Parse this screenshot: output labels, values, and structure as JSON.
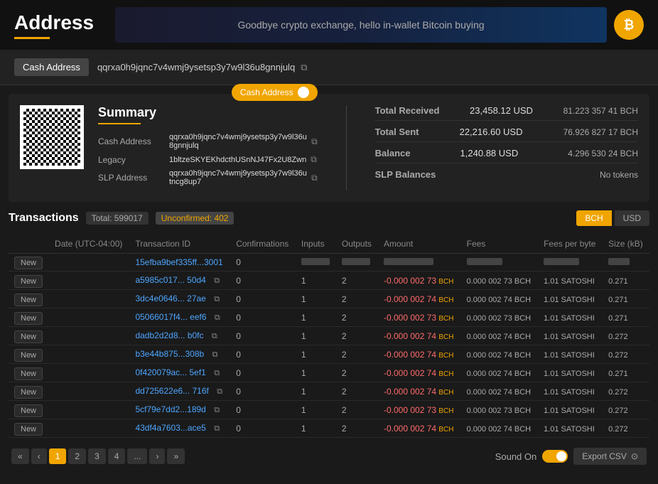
{
  "header": {
    "title": "Address",
    "banner_text": "Goodbye crypto exchange, hello in-wallet Bitcoin buying",
    "bitcoin_icon": "₿"
  },
  "address_bar": {
    "label": "Cash Address",
    "value": "qqrxa0h9jqnc7v4wmj9ysetsp3y7w9l36u8gnnjulq"
  },
  "summary": {
    "title": "Summary",
    "toggle_label": "Cash Address",
    "cash_address_label": "Cash Address",
    "cash_address_value": "qqrxa0h9jqnc7v4wmj9ysetsp3y7w9l36u8gnnjulq",
    "legacy_label": "Legacy",
    "legacy_value": "1bltzeSKYEKhdcthUSnNJ47Fx2U8Zwn",
    "slp_address_label": "SLP Address",
    "slp_address_value": "qqrxa0h9jqnc7v4wmj9ysetsp3y7w9l36utncg8up7",
    "total_received_label": "Total Received",
    "total_received_usd": "23,458.12 USD",
    "total_received_bch": "81.223 357 41 BCH",
    "total_sent_label": "Total Sent",
    "total_sent_usd": "22,216.60 USD",
    "total_sent_bch": "76.926 827 17 BCH",
    "balance_label": "Balance",
    "balance_usd": "1,240.88 USD",
    "balance_bch": "4.296 530 24 BCH",
    "slp_balances_label": "SLP Balances",
    "slp_balances_value": "No tokens"
  },
  "transactions": {
    "title": "Transactions",
    "total_badge": "Total: 599017",
    "unconfirmed_badge": "Unconfirmed: 402",
    "btn_bch": "BCH",
    "btn_usd": "USD",
    "columns": [
      "Date (UTC-04:00)",
      "Transaction ID",
      "Confirmations",
      "Inputs",
      "Outputs",
      "Amount",
      "Fees",
      "Fees per byte",
      "Size (kB)"
    ],
    "rows": [
      {
        "is_new": true,
        "date": "",
        "tx_id": "15efba9bef335ff...3001",
        "confirmations": "0",
        "inputs": "",
        "outputs": "",
        "amount": "",
        "fees": "",
        "fees_per_byte": "",
        "size": ""
      },
      {
        "is_new": true,
        "date": "",
        "tx_id": "a5985c017... 50d4",
        "has_copy": true,
        "confirmations": "0",
        "inputs": "1",
        "outputs": "2",
        "amount": "-0.000 002 73 BCH",
        "fees": "0.000 002 73 BCH",
        "fees_per_byte": "1.01 SATOSHI",
        "size": "0.271"
      },
      {
        "is_new": true,
        "date": "",
        "tx_id": "3dc4e0646... 27ae",
        "has_copy": true,
        "confirmations": "0",
        "inputs": "1",
        "outputs": "2",
        "amount": "-0.000 002 74 BCH",
        "fees": "0.000 002 74 BCH",
        "fees_per_byte": "1.01 SATOSHI",
        "size": "0.271"
      },
      {
        "is_new": true,
        "date": "",
        "tx_id": "05066017f4... eef6",
        "has_copy": true,
        "confirmations": "0",
        "inputs": "1",
        "outputs": "2",
        "amount": "-0.000 002 73 BCH",
        "fees": "0.000 002 73 BCH",
        "fees_per_byte": "1.01 SATOSHI",
        "size": "0.271"
      },
      {
        "is_new": true,
        "date": "",
        "tx_id": "dadb2d2d8... b0fc",
        "has_copy": true,
        "confirmations": "0",
        "inputs": "1",
        "outputs": "2",
        "amount": "-0.000 002 74 BCH",
        "fees": "0.000 002 74 BCH",
        "fees_per_byte": "1.01 SATOSHI",
        "size": "0.272"
      },
      {
        "is_new": true,
        "date": "",
        "tx_id": "b3e44b875...308b",
        "has_copy": true,
        "confirmations": "0",
        "inputs": "1",
        "outputs": "2",
        "amount": "-0.000 002 74 BCH",
        "fees": "0.000 002 74 BCH",
        "fees_per_byte": "1.01 SATOSHI",
        "size": "0.272"
      },
      {
        "is_new": true,
        "date": "",
        "tx_id": "0f420079ac... 5ef1",
        "has_copy": true,
        "confirmations": "0",
        "inputs": "1",
        "outputs": "2",
        "amount": "-0.000 002 74 BCH",
        "fees": "0.000 002 74 BCH",
        "fees_per_byte": "1.01 SATOSHI",
        "size": "0.271"
      },
      {
        "is_new": true,
        "date": "",
        "tx_id": "dd725622e6... 716f",
        "has_copy": true,
        "confirmations": "0",
        "inputs": "1",
        "outputs": "2",
        "amount": "-0.000 002 74 BCH",
        "fees": "0.000 002 74 BCH",
        "fees_per_byte": "1.01 SATOSHI",
        "size": "0.272"
      },
      {
        "is_new": true,
        "date": "",
        "tx_id": "5cf79e7dd2...189d",
        "has_copy": true,
        "confirmations": "0",
        "inputs": "1",
        "outputs": "2",
        "amount": "-0.000 002 73 BCH",
        "fees": "0.000 002 73 BCH",
        "fees_per_byte": "1.01 SATOSHI",
        "size": "0.272"
      },
      {
        "is_new": true,
        "date": "",
        "tx_id": "43df4a7603...ace5",
        "has_copy": true,
        "confirmations": "0",
        "inputs": "1",
        "outputs": "2",
        "amount": "-0.000 002 74 BCH",
        "fees": "0.000 002 74 BCH",
        "fees_per_byte": "1.01 SATOSHI",
        "size": "0.272"
      }
    ]
  },
  "pagination": {
    "first": "«",
    "prev": "‹",
    "pages": [
      "1",
      "2",
      "3",
      "4",
      "...",
      "›",
      "»"
    ],
    "active_page": "1"
  },
  "sound": {
    "label": "Sound On",
    "export_label": "Export CSV"
  }
}
